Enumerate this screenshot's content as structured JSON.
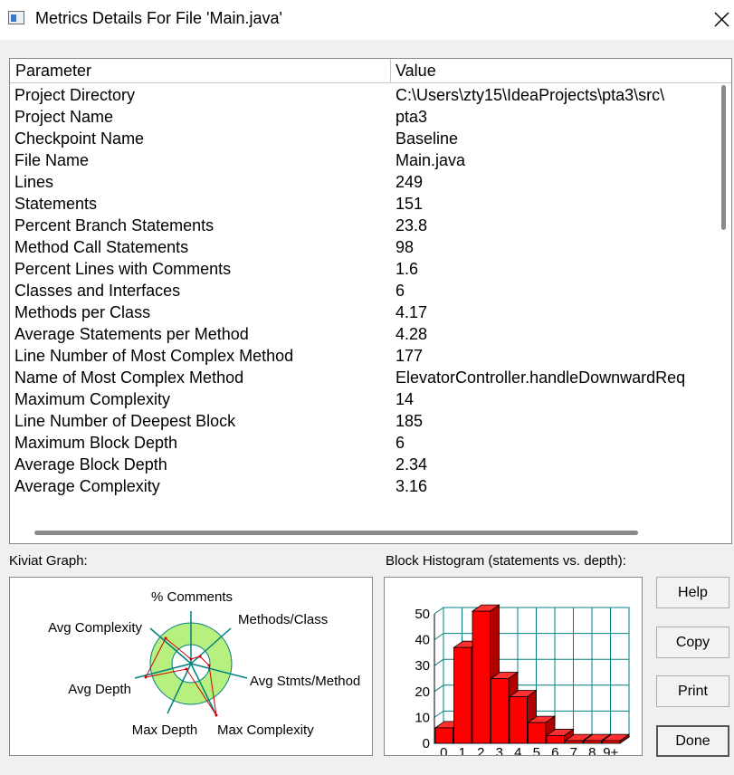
{
  "window": {
    "title": "Metrics Details For File 'Main.java'"
  },
  "table": {
    "headers": {
      "parameter": "Parameter",
      "value": "Value"
    },
    "rows": [
      {
        "parameter": "Project Directory",
        "value": "C:\\Users\\zty15\\IdeaProjects\\pta3\\src\\"
      },
      {
        "parameter": "Project Name",
        "value": "pta3"
      },
      {
        "parameter": "Checkpoint Name",
        "value": "Baseline"
      },
      {
        "parameter": "File Name",
        "value": "Main.java"
      },
      {
        "parameter": "Lines",
        "value": "249"
      },
      {
        "parameter": "Statements",
        "value": "151"
      },
      {
        "parameter": "Percent Branch Statements",
        "value": "23.8"
      },
      {
        "parameter": "Method Call Statements",
        "value": "98"
      },
      {
        "parameter": "Percent Lines with Comments",
        "value": "1.6"
      },
      {
        "parameter": "Classes and Interfaces",
        "value": "6"
      },
      {
        "parameter": "Methods per Class",
        "value": "4.17"
      },
      {
        "parameter": "Average Statements per Method",
        "value": "4.28"
      },
      {
        "parameter": "Line Number of Most Complex Method",
        "value": "177"
      },
      {
        "parameter": "Name of Most Complex Method",
        "value": "ElevatorController.handleDownwardReq"
      },
      {
        "parameter": "Maximum Complexity",
        "value": "14"
      },
      {
        "parameter": "Line Number of Deepest Block",
        "value": "185"
      },
      {
        "parameter": "Maximum Block Depth",
        "value": "6"
      },
      {
        "parameter": "Average Block Depth",
        "value": "2.34"
      },
      {
        "parameter": "Average Complexity",
        "value": "3.16"
      }
    ]
  },
  "kiviat": {
    "label": "Kiviat Graph:",
    "axes": {
      "comments": "% Comments",
      "methods_class": "Methods/Class",
      "avg_stmts": "Avg Stmts/Method",
      "max_complexity": "Max Complexity",
      "max_depth": "Max Depth",
      "avg_depth": "Avg Depth",
      "avg_complexity": "Avg Complexity"
    }
  },
  "histogram": {
    "label": "Block Histogram (statements vs. depth):"
  },
  "buttons": {
    "help": "Help",
    "copy": "Copy",
    "print": "Print",
    "done": "Done"
  },
  "colors": {
    "bar": "#ff0000",
    "grid": "#008080",
    "kiviat_band": "#b8f080"
  },
  "chart_data": {
    "type": "bar",
    "title": "Block Histogram (statements vs. depth):",
    "categories": [
      "0",
      "1",
      "2",
      "3",
      "4",
      "5",
      "6",
      "7",
      "8",
      "9+"
    ],
    "values": [
      6,
      37,
      51,
      25,
      18,
      8,
      3,
      1,
      1,
      1
    ],
    "yticks": [
      "0",
      "10",
      "20",
      "30",
      "40",
      "50"
    ],
    "ylim": [
      0,
      50
    ],
    "grid": true
  }
}
